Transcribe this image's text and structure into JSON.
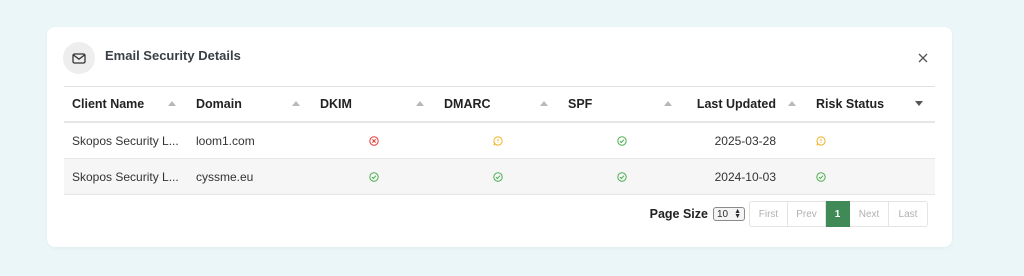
{
  "panel": {
    "title": "Email Security Details",
    "mail_icon": "mail-icon",
    "close_icon": "close-icon"
  },
  "columns": [
    "Client Name",
    "Domain",
    "DKIM",
    "DMARC",
    "SPF",
    "Last Updated",
    "Risk Status"
  ],
  "rows": [
    {
      "client": "Skopos Security L...",
      "domain": "loom1.com",
      "dkim": "error",
      "dmarc": "warning",
      "spf": "ok",
      "updated": "2025-03-28",
      "risk": "warning"
    },
    {
      "client": "Skopos Security L...",
      "domain": "cyssme.eu",
      "dkim": "ok",
      "dmarc": "ok",
      "spf": "ok",
      "updated": "2024-10-03",
      "risk": "ok"
    }
  ],
  "pagination": {
    "page_size_label": "Page Size",
    "page_size_value": "10",
    "first": "First",
    "prev": "Prev",
    "current": "1",
    "next": "Next",
    "last": "Last"
  },
  "colors": {
    "ok": "#4caf50",
    "warning": "#f0b429",
    "error": "#e53935",
    "active_page": "#3f8a57"
  }
}
